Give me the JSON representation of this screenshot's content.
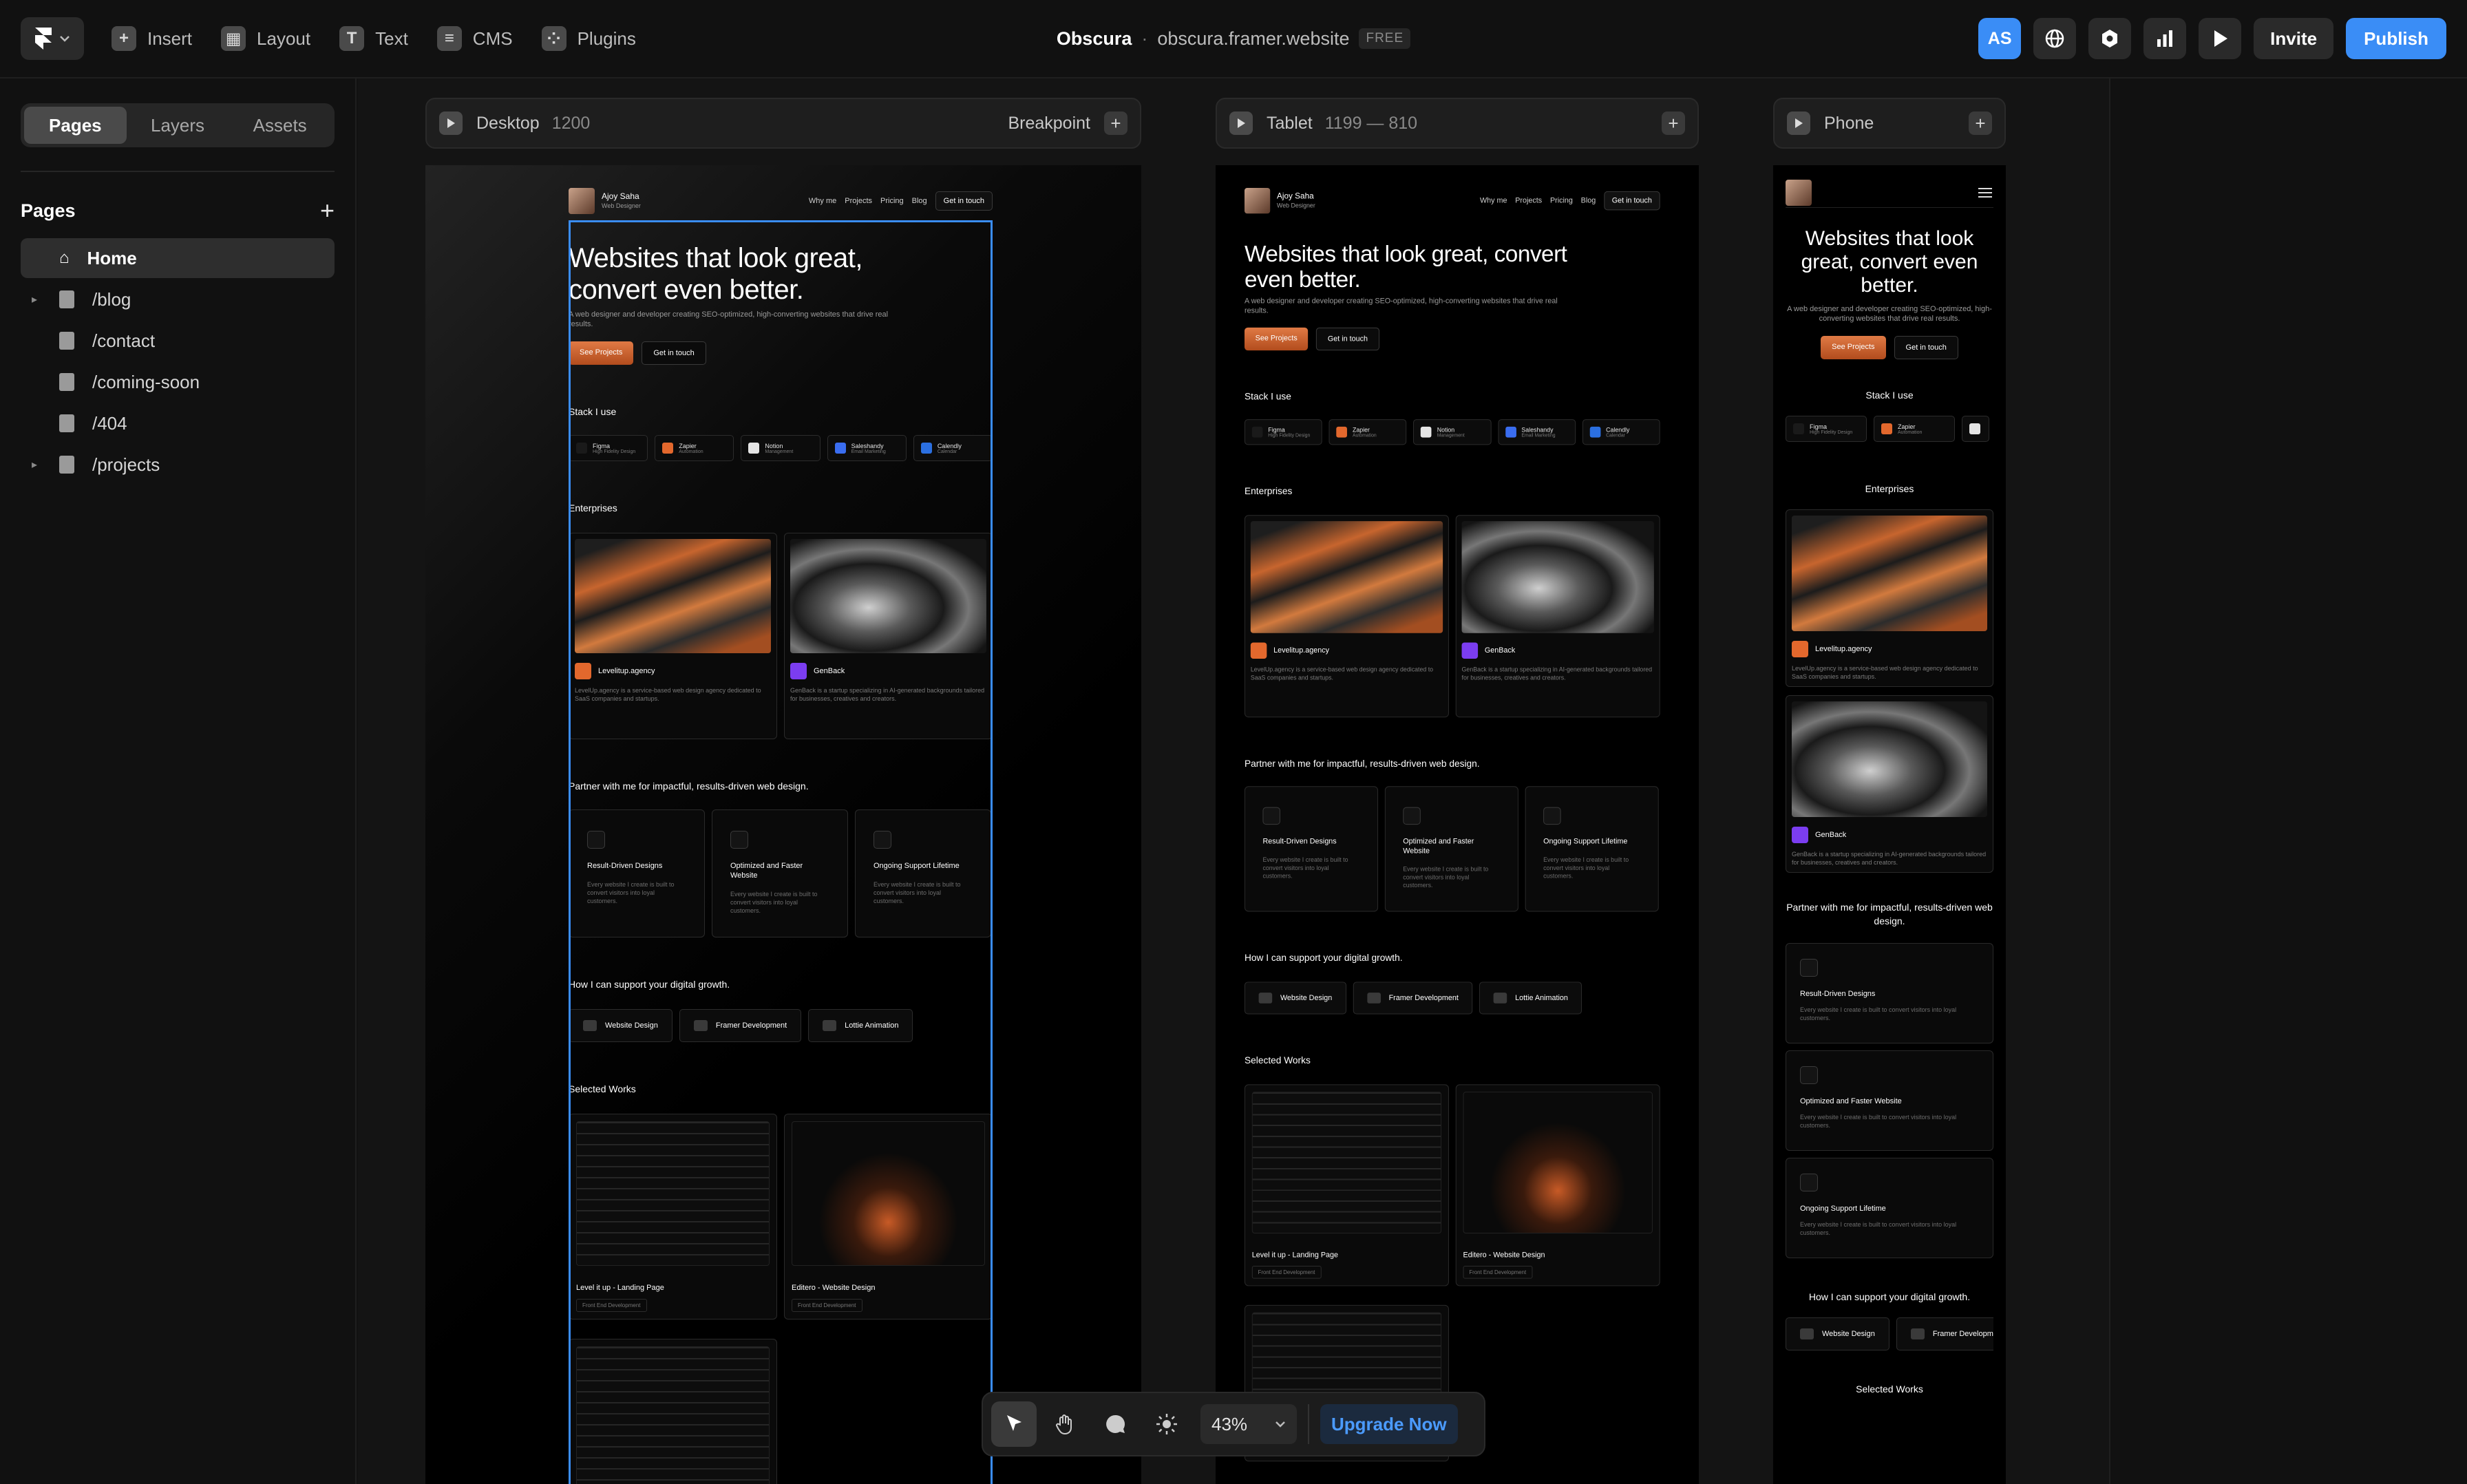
{
  "topbar": {
    "menu": [
      {
        "label": "Insert",
        "icon": "plus-square-icon",
        "glyph": "+"
      },
      {
        "label": "Layout",
        "icon": "layout-icon",
        "glyph": "▦"
      },
      {
        "label": "Text",
        "icon": "text-icon",
        "glyph": "T"
      },
      {
        "label": "CMS",
        "icon": "database-icon",
        "glyph": "≡"
      },
      {
        "label": "Plugins",
        "icon": "plugins-icon",
        "glyph": "⁘"
      }
    ],
    "project_name": "Obscura",
    "separator": "·",
    "project_url": "obscura.framer.website",
    "plan_badge": "FREE",
    "avatar_initials": "AS",
    "invite_label": "Invite",
    "publish_label": "Publish",
    "accent": "#3a8df6"
  },
  "sidebar": {
    "tabs": [
      "Pages",
      "Layers",
      "Assets"
    ],
    "active_tab": "Pages",
    "pages_heading": "Pages",
    "pages": [
      {
        "label": "Home",
        "icon": "home-icon",
        "expandable": false,
        "active": true
      },
      {
        "label": "/blog",
        "icon": "file-icon",
        "expandable": true,
        "active": false
      },
      {
        "label": "/contact",
        "icon": "file-icon",
        "expandable": false,
        "active": false
      },
      {
        "label": "/coming-soon",
        "icon": "file-icon",
        "expandable": false,
        "active": false
      },
      {
        "label": "/404",
        "icon": "file-icon",
        "expandable": false,
        "active": false
      },
      {
        "label": "/projects",
        "icon": "file-icon",
        "expandable": true,
        "active": false
      }
    ]
  },
  "breakpoints": {
    "desktop": {
      "label": "Desktop",
      "size": "1200",
      "action": "Breakpoint"
    },
    "tablet": {
      "label": "Tablet",
      "size": "1199 — 810"
    },
    "phone": {
      "label": "Phone"
    }
  },
  "site": {
    "brand_name": "Ajoy Saha",
    "brand_role": "Web Designer",
    "nav_links": [
      "Why me",
      "Projects",
      "Pricing",
      "Blog"
    ],
    "nav_cta": "Get in touch",
    "headline": "Websites that look great, convert even better.",
    "subhead": "A web designer and developer creating SEO-optimized, high-converting websites that drive real results.",
    "cta_primary": "See Projects",
    "cta_secondary": "Get in touch",
    "stack_heading": "Stack I use",
    "stack": [
      {
        "name": "Figma",
        "desc": "High Fidelity Design",
        "color": "#1a1a1a"
      },
      {
        "name": "Zapier",
        "desc": "Automation",
        "color": "#e3682d"
      },
      {
        "name": "Notion",
        "desc": "Management",
        "color": "#e5e5e5"
      },
      {
        "name": "Saleshandy",
        "desc": "Email Marketing",
        "color": "#3a6df0"
      },
      {
        "name": "Calendly",
        "desc": "Calendar",
        "color": "#2b6fe0"
      }
    ],
    "enterprises_heading": "Enterprises",
    "enterprises": [
      {
        "name": "Levelitup.agency",
        "desc": "LevelUp.agency is a service-based web design agency dedicated to SaaS companies and startups.",
        "color": "#e3682d"
      },
      {
        "name": "GenBack",
        "desc": "GenBack is a startup specializing in AI-generated backgrounds tailored for businesses, creatives and creators.",
        "color": "#7b3df0"
      }
    ],
    "partner_heading": "Partner with me for impactful, results-driven web design.",
    "features": [
      {
        "title": "Result-Driven Designs",
        "desc": "Every website I create is built to convert visitors into loyal customers."
      },
      {
        "title": "Optimized and Faster Website",
        "desc": "Every website I create is built to convert visitors into loyal customers."
      },
      {
        "title": "Ongoing Support Lifetime",
        "desc": "Every website I create is built to convert visitors into loyal customers."
      }
    ],
    "support_heading": "How I can support your digital growth.",
    "services": [
      "Website Design",
      "Framer Development",
      "Lottie Animation"
    ],
    "works_heading": "Selected Works",
    "works": [
      {
        "title": "Level it up - Landing Page",
        "tag": "Front End Development"
      },
      {
        "title": "Editero - Website Design",
        "tag": "Front End Development"
      }
    ]
  },
  "toolbar": {
    "zoom": "43%",
    "upgrade_label": "Upgrade Now"
  }
}
